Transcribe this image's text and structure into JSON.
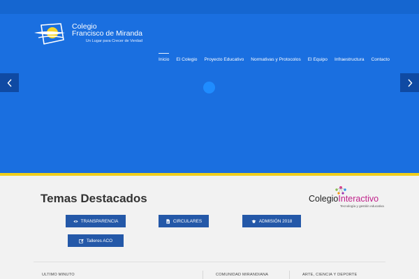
{
  "header": {
    "logo_line1": "Colegio",
    "logo_line2": "Francisco de Miranda",
    "tagline": "Un Lugar para Crecer de Verdad"
  },
  "nav": {
    "items": [
      {
        "label": "Inicio",
        "active": true
      },
      {
        "label": "El Colegio"
      },
      {
        "label": "Proyecto Educativo"
      },
      {
        "label": "Normativas y Protocolos"
      },
      {
        "label": "El Equipo"
      },
      {
        "label": "Infraestructura"
      },
      {
        "label": "Contacto"
      }
    ]
  },
  "slider": {
    "prev_icon": "chevron-left-icon",
    "next_icon": "chevron-right-icon"
  },
  "featured": {
    "title": "Temas Destacados",
    "buttons": [
      {
        "label": "TRANSPARENCIA",
        "icon": "eye-icon"
      },
      {
        "label": "CIRCULARES",
        "icon": "document-icon"
      },
      {
        "label": "ADMISIÓN 2018",
        "icon": "graduation-cap-icon"
      },
      {
        "label": "Talleres ACO",
        "icon": "edit-icon"
      }
    ]
  },
  "partner": {
    "word1": "Colegio",
    "word2": "Interactivo",
    "subtitle": "Tecnología y gestión educativa"
  },
  "bottom": {
    "columns": [
      "ULTIMO MINUTO",
      "COMUNIDAD MIRANDIANA",
      "ARTE, CIENCIA Y DEPORTE"
    ]
  },
  "colors": {
    "hero_blue": "#1a6fe0",
    "button_blue": "#2458a8",
    "accent_yellow": "#f2cf1b",
    "partner_magenta": "#c0208a"
  }
}
